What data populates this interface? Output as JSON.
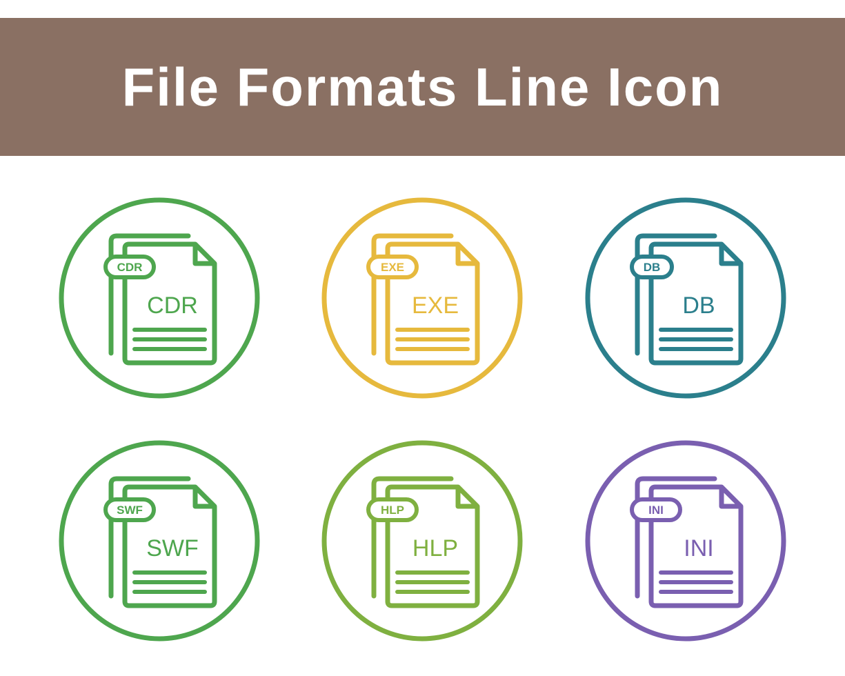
{
  "header": {
    "title": "File Formats Line Icon",
    "background": "#8a7063",
    "text_color": "#ffffff"
  },
  "icons": [
    {
      "label": "CDR",
      "tag": "CDR",
      "color": "#4ea64e"
    },
    {
      "label": "EXE",
      "tag": "EXE",
      "color": "#e6b93d"
    },
    {
      "label": "DB",
      "tag": "DB",
      "color": "#2b7f8c"
    },
    {
      "label": "SWF",
      "tag": "SWF",
      "color": "#4ea64e"
    },
    {
      "label": "HLP",
      "tag": "HLP",
      "color": "#7fb040"
    },
    {
      "label": "INI",
      "tag": "INI",
      "color": "#7a5fb0"
    }
  ]
}
